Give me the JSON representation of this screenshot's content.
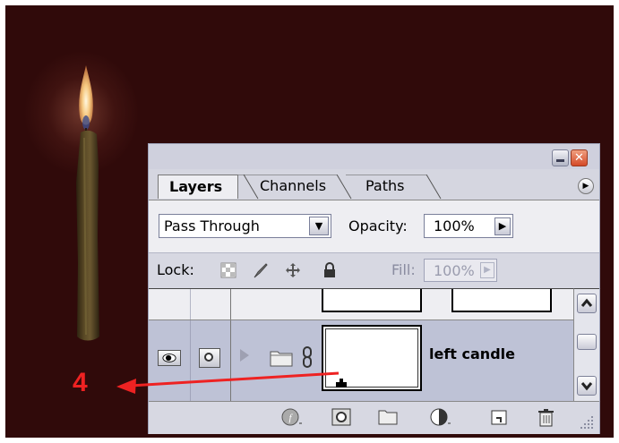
{
  "panel": {
    "tabs": [
      {
        "label": "Layers",
        "active": true
      },
      {
        "label": "Channels",
        "active": false
      },
      {
        "label": "Paths",
        "active": false
      }
    ],
    "close_glyph": "✕",
    "menu_glyph": "▶"
  },
  "options": {
    "blend_mode": "Pass Through",
    "dropdown_glyph": "▼",
    "opacity_label": "Opacity:",
    "opacity_value": "100%",
    "stepper_glyph": "▶"
  },
  "lock": {
    "label": "Lock:",
    "fill_label": "Fill:",
    "fill_value": "100%",
    "icons": [
      "lock-transparent-icon",
      "lock-image-icon",
      "lock-position-icon",
      "lock-all-icon"
    ]
  },
  "layers": [
    {
      "name": "",
      "visible": true,
      "selected": false,
      "partially_hidden": true
    },
    {
      "name": "left candle",
      "visible": true,
      "selected": true,
      "type": "group"
    }
  ],
  "bottom_toolbar": {
    "icons": [
      "layer-style-icon",
      "add-mask-icon",
      "new-group-icon",
      "adjustment-layer-icon",
      "new-layer-icon",
      "delete-layer-icon"
    ]
  },
  "annotation": {
    "number": "4",
    "color": "#ee2222"
  },
  "colors": {
    "canvas_background": "#300a0a",
    "panel_background": "#d5d6e0",
    "selected_layer": "#bec2d6",
    "close_button": "#d44a28"
  }
}
